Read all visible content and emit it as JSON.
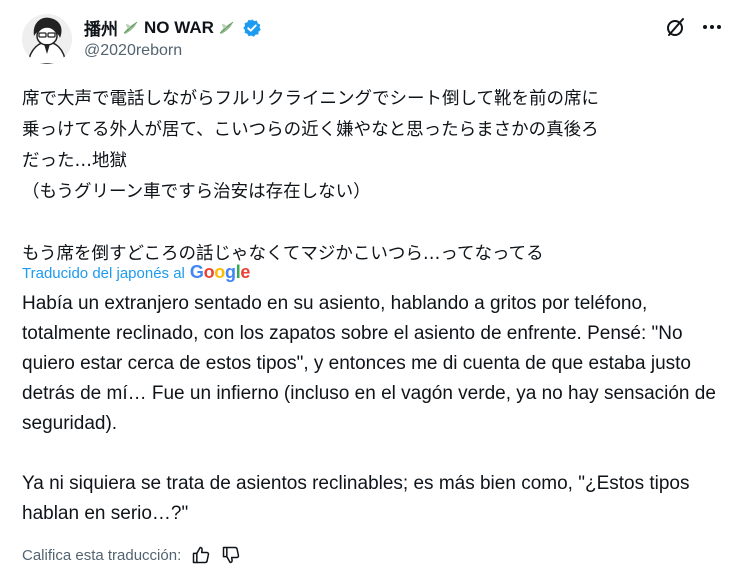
{
  "author": {
    "display_name_prefix": "播州",
    "display_name_middle": "NO WAR",
    "handle": "@2020reborn",
    "verified": true,
    "accent_color": "#1d9bf0"
  },
  "icons": {
    "grok": "grok-icon",
    "more": "more-icon",
    "verified": "verified-badge-icon",
    "leaf": "dove-leaf-icon",
    "thumb_up": "thumbs-up-icon",
    "thumb_down": "thumbs-down-icon"
  },
  "original": {
    "paragraph1": "席で大声で電話しながらフルリクライニングでシート倒して靴を前の席に\n乗っけてる外人が居て、こいつらの近く嫌やなと思ったらまさかの真後ろ\nだった…地獄\n（もうグリーン車ですら治安は存在しない）",
    "paragraph2": "もう席を倒すどころの話じゃなくてマジかこいつら…ってなってる"
  },
  "translation_attribution": {
    "label": "Traducido del japonés al",
    "provider": "Google"
  },
  "translation": {
    "paragraph1": "Había un extranjero sentado en su asiento, hablando a gritos por teléfono, totalmente reclinado, con los zapatos sobre el asiento de enfrente. Pensé: \"No quiero estar cerca de estos tipos\", y entonces me di cuenta de que estaba justo detrás de mí… Fue un infierno (incluso en el vagón verde, ya no hay sensación de seguridad).",
    "paragraph2": "Ya ni siquiera se trata de asientos reclinables; es más bien como, \"¿Estos tipos hablan en serio…?\""
  },
  "rate": {
    "label": "Califica esta traducción:"
  }
}
